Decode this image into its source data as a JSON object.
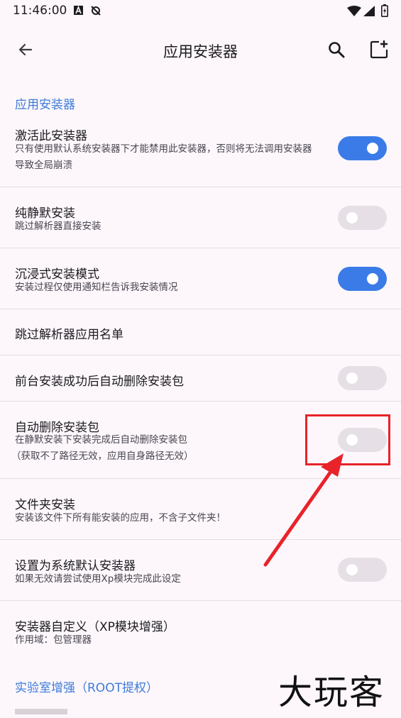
{
  "status_bar": {
    "time": "11:46:00"
  },
  "app_bar": {
    "title": "应用安装器"
  },
  "section1": {
    "title": "应用安装器"
  },
  "items": [
    {
      "title": "激活此安装器",
      "summary": "只有使用默认系统安装器下才能禁用此安装器，否则将无法调用安装器导致全局崩溃",
      "switch": "on"
    },
    {
      "title": "纯静默安装",
      "summary": "跳过解析器直接安装",
      "switch": "off"
    },
    {
      "title": "沉浸式安装模式",
      "summary": "安装过程仅使用通知栏告诉我安装情况",
      "switch": "on"
    },
    {
      "title": "跳过解析器应用名单"
    },
    {
      "title": "前台安装成功后自动删除安装包",
      "switch": "off"
    },
    {
      "title": "自动删除安装包",
      "summary": "在静默安装下安装完成后自动删除安装包",
      "summary2": "（获取不了路径无效，应用自身路径无效）",
      "switch": "off"
    },
    {
      "title": "文件夹安装",
      "summary": "安装该文件下所有能安装的应用，不含子文件夹！"
    },
    {
      "title": "设置为系统默认安装器",
      "summary": "如果无效请尝试使用Xp模块完成此设定",
      "switch": "off"
    },
    {
      "title": "安装器自定义（XP模块增强）",
      "summary": "作用域：包管理器"
    }
  ],
  "section2": {
    "title": "实验室增强（ROOT提权）"
  },
  "watermark": "大玩客",
  "colors": {
    "accent": "#3a7be8",
    "highlight": "#e8232a",
    "section": "#3d7bd8"
  }
}
